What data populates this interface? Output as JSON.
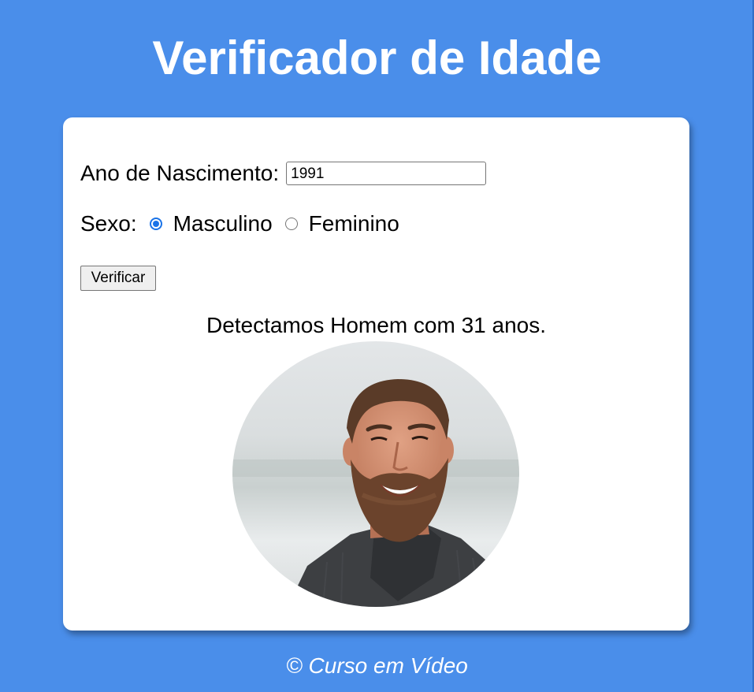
{
  "header": {
    "title": "Verificador de Idade"
  },
  "form": {
    "year_label": "Ano de Nascimento:",
    "year_value": "1991",
    "sex_label": "Sexo:",
    "options": [
      {
        "label": "Masculino",
        "checked": true
      },
      {
        "label": "Feminino",
        "checked": false
      }
    ],
    "submit_label": "Verificar"
  },
  "result": {
    "text": "Detectamos Homem com 31 anos.",
    "image_subject": "bearded-man-portrait"
  },
  "footer": {
    "text": "© Curso em Vídeo"
  },
  "colors": {
    "background": "#4a8eea",
    "card": "#ffffff",
    "radio_accent": "#1a73e8"
  }
}
